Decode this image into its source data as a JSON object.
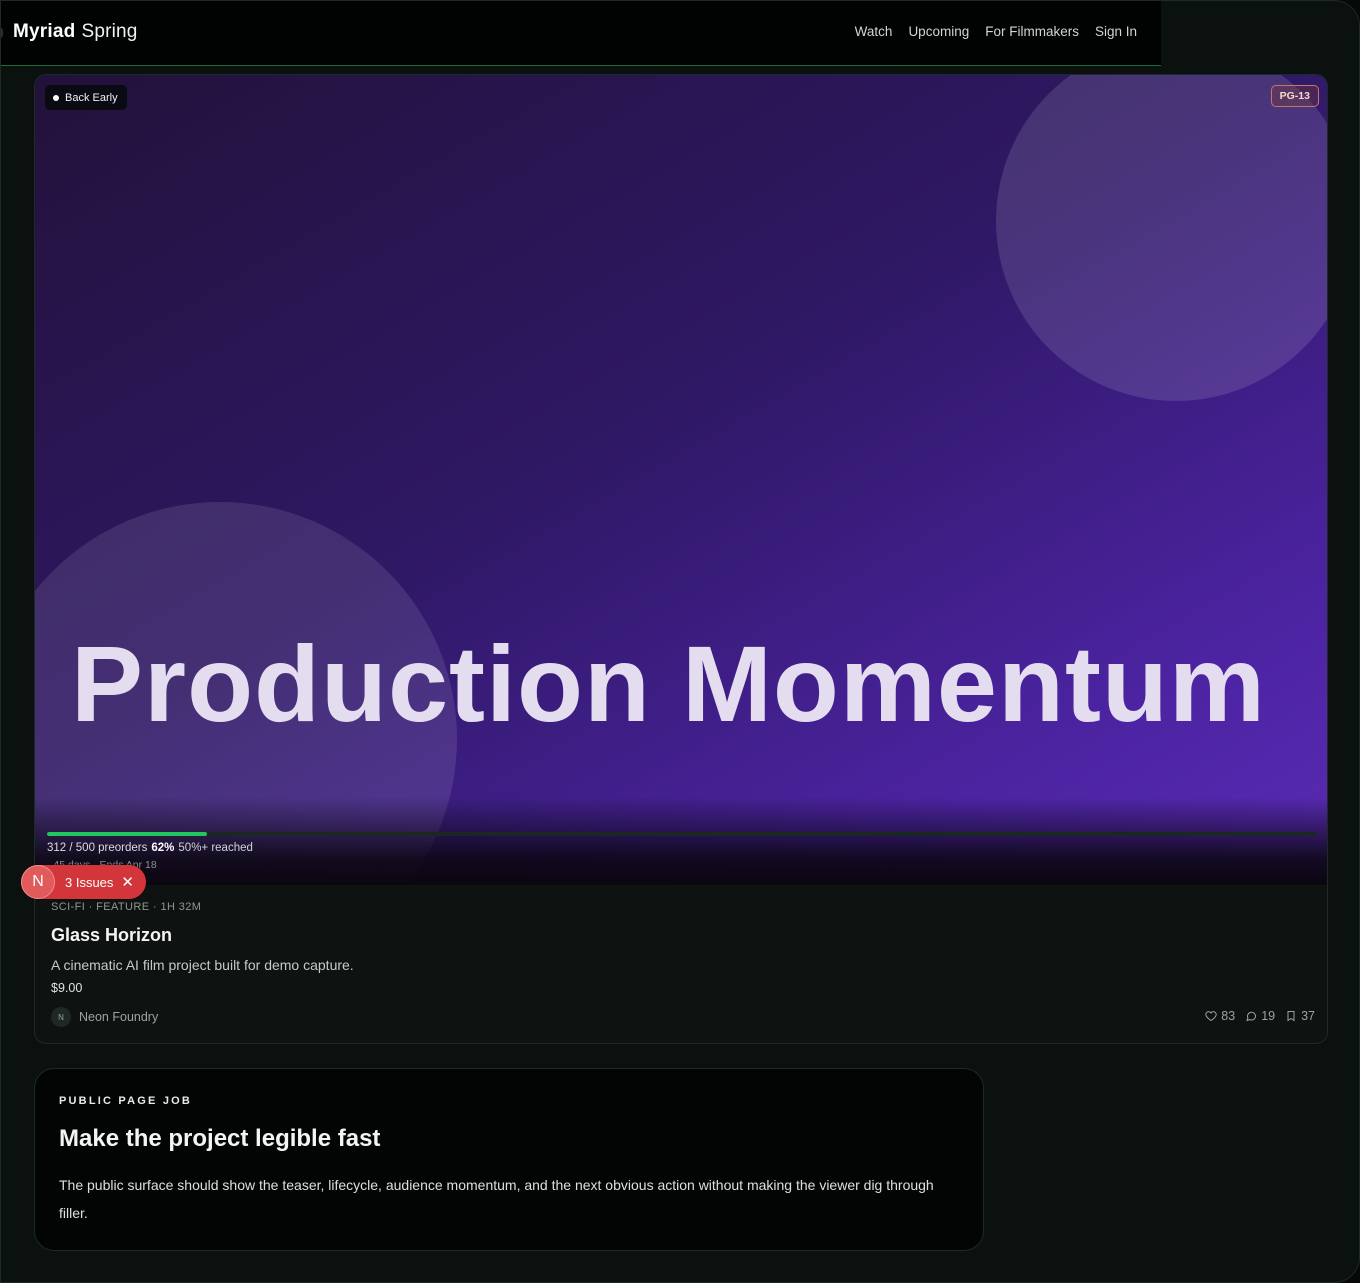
{
  "brand": {
    "name_bold": "Myriad",
    "name_light": "Spring"
  },
  "nav": {
    "watch": "Watch",
    "upcoming": "Upcoming",
    "filmmakers": "For Filmmakers",
    "sign_in": "Sign In"
  },
  "hero": {
    "badge": "Back Early",
    "rating": "PG-13",
    "title": "Production Momentum",
    "progress": {
      "count": "312 / 500 preorders",
      "percent_label": "62%",
      "reached": "50%+ reached",
      "fraction": 0.126
    },
    "partial_line": "· 45 days · Ends Apr 18"
  },
  "film": {
    "meta": "SCI-FI · FEATURE · 1H 32M",
    "title": "Glass Horizon",
    "description": "A cinematic AI film project built for demo capture.",
    "price": "$9.00",
    "creator_initial": "N",
    "creator": "Neon Foundry",
    "likes": "83",
    "comments": "19",
    "saves": "37"
  },
  "issues": {
    "initial": "N",
    "label": "3 Issues"
  },
  "panel": {
    "eyebrow": "PUBLIC PAGE JOB",
    "title": "Make the project legible fast",
    "body": "The public surface should show the teaser, lifecycle, audience momentum, and the next obvious action without making the viewer dig through filler."
  },
  "colors": {
    "accent_green": "#22c55e",
    "issues_red": "#d2363a",
    "hero_purple": "#4b23a0"
  }
}
